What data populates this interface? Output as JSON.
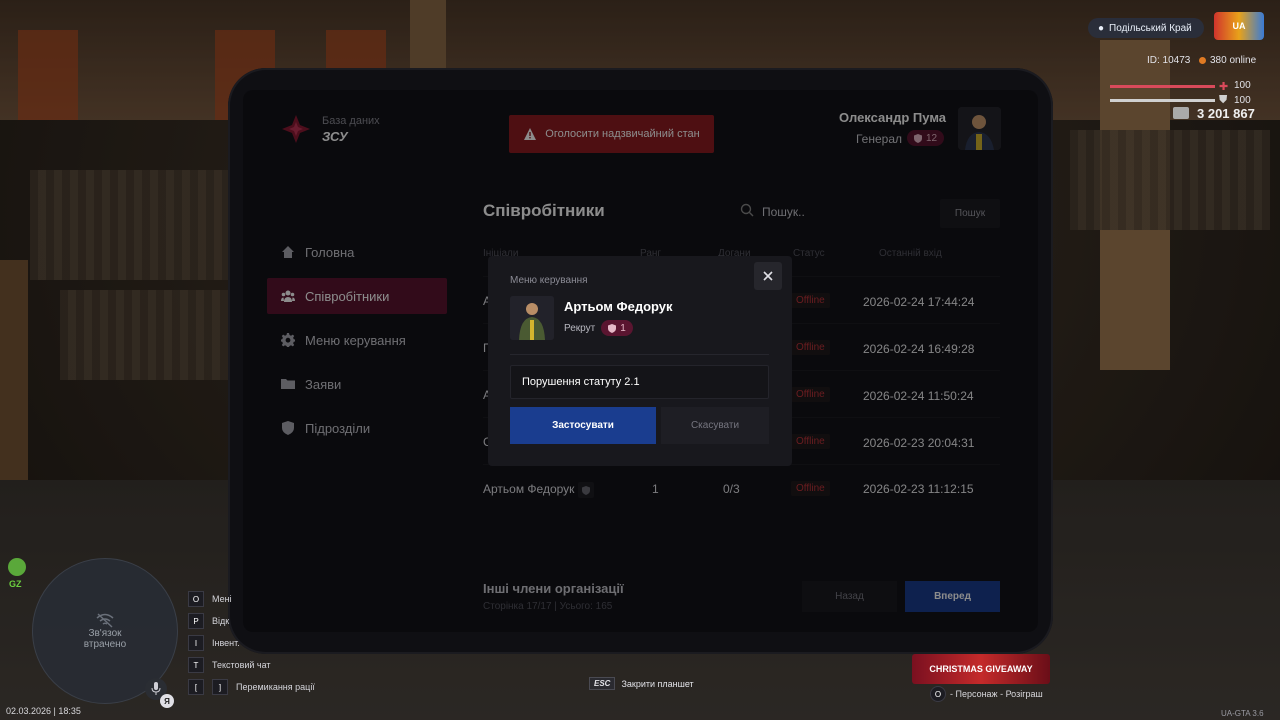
{
  "tablet": {
    "db_subtitle": "База даних",
    "db_title": "ЗСУ",
    "alert_button": "Оголосити надзвичайний стан",
    "user": {
      "name": "Олександр Пума",
      "rank": "Генерал",
      "level": "12"
    }
  },
  "nav": [
    {
      "label": "Головна",
      "icon": "home-icon"
    },
    {
      "label": "Співробітники",
      "icon": "users-icon",
      "active": true
    },
    {
      "label": "Меню керування",
      "icon": "gear-icon"
    },
    {
      "label": "Заяви",
      "icon": "folder-icon"
    },
    {
      "label": "Підрозділи",
      "icon": "shield-icon"
    }
  ],
  "employees": {
    "title": "Співробітники",
    "search_placeholder": "Пошук..",
    "search_button": "Пошук",
    "columns": [
      "Ініціали",
      "Ранг",
      "Догани",
      "Статус",
      "Останній вхід"
    ],
    "rows": [
      {
        "name": "А",
        "rank": "",
        "warns": "",
        "status": "Offline",
        "last": "2026-02-24 17:44:24"
      },
      {
        "name": "П",
        "rank": "",
        "warns": "",
        "status": "Offline",
        "last": "2026-02-24 16:49:28"
      },
      {
        "name": "А",
        "rank": "",
        "warns": "",
        "status": "Offline",
        "last": "2026-02-24 11:50:24"
      },
      {
        "name": "С",
        "rank": "",
        "warns": "",
        "status": "Offline",
        "last": "2026-02-23 20:04:31"
      },
      {
        "name": "Артьом Федорук",
        "rank": "1",
        "warns": "0/3",
        "status": "Offline",
        "last": "2026-02-23 11:12:15"
      }
    ],
    "other_title": "Інші члени організації",
    "page_info": "Сторінка 17/17 | Усього: 165",
    "back_button": "Назад",
    "forward_button": "Вперед"
  },
  "modal": {
    "title": "Меню керування",
    "name": "Артьом Федорук",
    "rank": "Рекрут",
    "level": "1",
    "reason_value": "Порушення статуту 2.1",
    "apply_button": "Застосувати",
    "cancel_button": "Скасувати"
  },
  "hud": {
    "server": "Подільський Край",
    "id_text": "ID: 10473",
    "online_text": "380 online",
    "health": "100",
    "armor": "100",
    "health_fraction": 1.0,
    "armor_fraction": 1.0,
    "money": "3 201 867",
    "minimap_text": "Зв'язок\nвтрачено",
    "gz": "GZ",
    "mic_key": "Я",
    "datetime": "02.03.2026 | 18:35",
    "keys": [
      {
        "key": "O",
        "label": "Мені"
      },
      {
        "key": "P",
        "label": "Відк"
      },
      {
        "key": "I",
        "label": "Інвент."
      },
      {
        "key": "T",
        "label": "Текстовий чат"
      }
    ],
    "bracket_keys": [
      "[",
      "]"
    ],
    "bracket_label": "Перемикання рації",
    "esc_key": "ESC",
    "esc_label": "Закрити планшет",
    "promo_key": "O",
    "promo_label": "- Персонаж - Розіграш",
    "version": "UA-GTA 3.6"
  },
  "colors": {
    "accent": "#5c1530",
    "primary": "#1a3d8f",
    "danger": "#8e1d22",
    "offline": "#c0343a"
  }
}
